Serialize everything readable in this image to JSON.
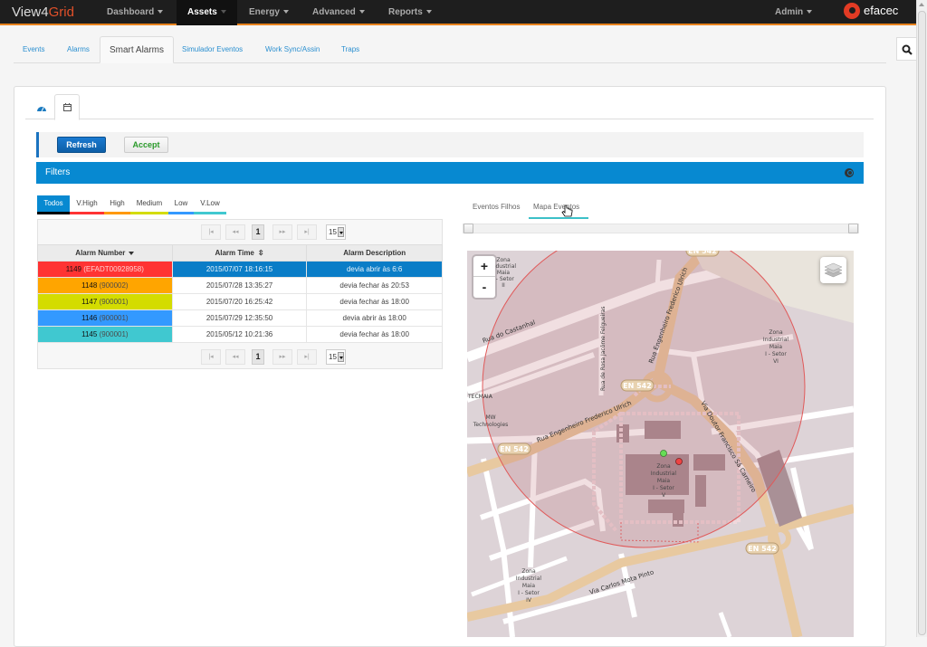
{
  "app": {
    "brand_main": "View4",
    "brand_accent": "Grid",
    "logo_text": "efacec"
  },
  "nav": {
    "items": [
      {
        "label": "Dashboard",
        "active": false
      },
      {
        "label": "Assets",
        "active": true
      },
      {
        "label": "Energy",
        "active": false
      },
      {
        "label": "Advanced",
        "active": false
      },
      {
        "label": "Reports",
        "active": false
      }
    ],
    "user": "Admin"
  },
  "subtabs": [
    {
      "label": "Events"
    },
    {
      "label": "Alarms"
    },
    {
      "label": "Smart Alarms",
      "active": true
    },
    {
      "label": "Simulador Eventos"
    },
    {
      "label": "Work Sync/Assin"
    },
    {
      "label": "Traps"
    }
  ],
  "inner_tabs": [
    {
      "icon": "dashboard-icon"
    },
    {
      "icon": "calendar-icon",
      "active": true
    }
  ],
  "toolbar": {
    "refresh_label": "Refresh",
    "accept_label": "Accept"
  },
  "filters": {
    "title": "Filters"
  },
  "priority_filters": [
    {
      "label": "Todos",
      "color": "#000000",
      "active": true
    },
    {
      "label": "V.High",
      "color": "#ff3333"
    },
    {
      "label": "High",
      "color": "#ff9900"
    },
    {
      "label": "Medium",
      "color": "#d4dc00"
    },
    {
      "label": "Low",
      "color": "#3399ff"
    },
    {
      "label": "V.Low",
      "color": "#40c8d0"
    }
  ],
  "pager": {
    "first": "|◂",
    "prev": "◂◂",
    "page": "1",
    "next": "▸▸",
    "last": "▸|",
    "page_size": "15"
  },
  "grid": {
    "columns": [
      "Alarm Number",
      "Alarm Time",
      "Alarm Description"
    ],
    "rows": [
      {
        "number": "1149",
        "ref": "(EFADT00928958)",
        "time": "2015/07/07 18:16:15",
        "description": "devia abrir às 6:6",
        "color": "#ff3333",
        "selected": true
      },
      {
        "number": "1148",
        "ref": "(900002)",
        "time": "2015/07/28 13:35:27",
        "description": "devia fechar às 20:53",
        "color": "#ffa500"
      },
      {
        "number": "1147",
        "ref": "(900001)",
        "time": "2015/07/20 16:25:42",
        "description": "devia fechar às 18:00",
        "color": "#d4dc00"
      },
      {
        "number": "1146",
        "ref": "(900001)",
        "time": "2015/07/29 12:35:50",
        "description": "devia abrir às 18:00",
        "color": "#3399ff"
      },
      {
        "number": "1145",
        "ref": "(900001)",
        "time": "2015/05/12 10:21:36",
        "description": "devia fechar às 18:00",
        "color": "#40c8d0"
      }
    ]
  },
  "right_tabs": [
    {
      "label": "Eventos Filhos"
    },
    {
      "label": "Mapa Eventos",
      "active": true
    }
  ],
  "map": {
    "zoom_in": "+",
    "zoom_out": "-",
    "labels": {
      "rua_castanhal": "Rua do Castanhal",
      "rua_rosa": "Rua de Rosa Jacôme Felgueiras",
      "rua_eng_ulrich": "Rua Engenheiro Frederico Ulrich",
      "via_sa_carneiro": "Via Doutor Francisco Sá Carneiro",
      "via_mota_pinto": "Via Carlos Mota Pinto",
      "en542": "EN 542",
      "tecmaia": "TECMAIA",
      "mw_tech_1": "MW",
      "mw_tech_2": "Technologies",
      "zona_ii": [
        "Zona",
        "Industrial",
        "Maia",
        "I - Setor",
        "II"
      ],
      "zona_vi": [
        "Zona",
        "Industrial",
        "Maia",
        "I - Setor",
        "VI"
      ],
      "zona_v": [
        "Zona",
        "Industrial",
        "Maia",
        "I - Setor",
        "V"
      ],
      "zona_iv": [
        "Zona",
        "Industrial",
        "Maia",
        "I - Setor",
        "IV"
      ]
    },
    "markers": [
      {
        "name": "green-marker",
        "color": "#66dd55"
      },
      {
        "name": "red-marker",
        "color": "#ee4444"
      }
    ]
  }
}
